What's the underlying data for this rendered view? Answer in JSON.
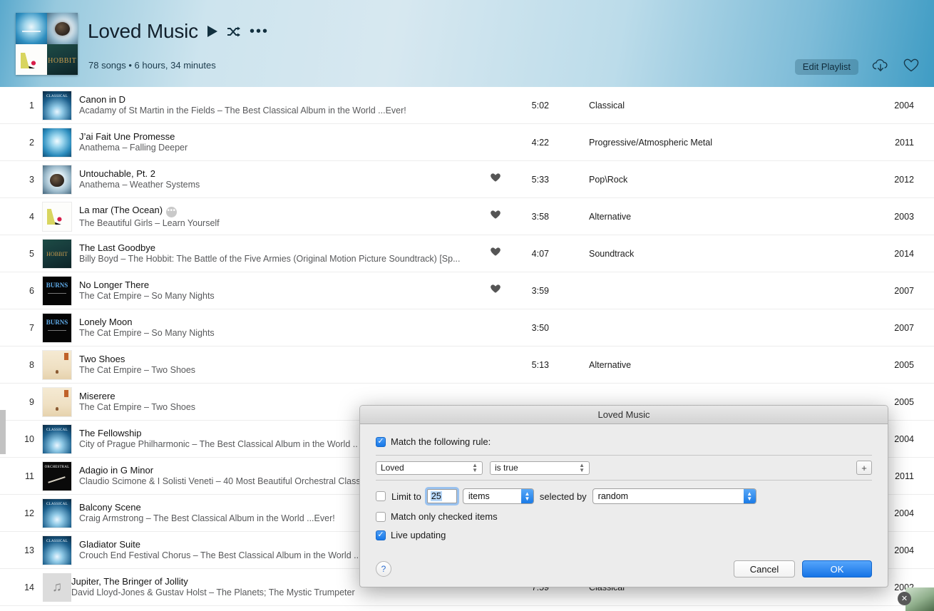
{
  "header": {
    "playlist_title": "Loved Music",
    "play_icon": "play-icon",
    "shuffle_icon": "shuffle-icon",
    "more_icon": "ellipsis-icon",
    "more_glyph": "•••",
    "shuffle_glyph": "⤨",
    "subtitle": "78 songs • 6 hours, 34 minutes",
    "edit_playlist_label": "Edit Playlist",
    "cloud_icon": "cloud-download-icon",
    "heart_icon": "heart-outline-icon",
    "accent_blue": "#3f9cc4",
    "title_color": "#12202c"
  },
  "tracks": [
    {
      "index": "1",
      "title": "Canon in D",
      "subtitle": "Acadamy of St Martin in the Fields – The Best Classical Album in the World ...Ever!",
      "loved": false,
      "time": "5:02",
      "genre": "Classical",
      "year": "2004",
      "art": "a-class",
      "badge": ""
    },
    {
      "index": "2",
      "title": "J’ai Fait Une Promesse",
      "subtitle": "Anathema – Falling Deeper",
      "loved": false,
      "time": "4:22",
      "genre": "Progressive/Atmospheric  Metal",
      "year": "2011",
      "art": "a-anat1",
      "badge": ""
    },
    {
      "index": "3",
      "title": "Untouchable, Pt. 2",
      "subtitle": "Anathema – Weather Systems",
      "loved": true,
      "time": "5:33",
      "genre": "Pop\\Rock",
      "year": "2012",
      "art": "a-anat2",
      "badge": ""
    },
    {
      "index": "4",
      "title": "La mar (The Ocean)",
      "subtitle": "The Beautiful Girls – Learn Yourself",
      "loved": true,
      "time": "3:58",
      "genre": "Alternative",
      "year": "2003",
      "art": "a-bg",
      "badge": "•••"
    },
    {
      "index": "5",
      "title": "The Last Goodbye",
      "subtitle": "Billy Boyd – The Hobbit: The Battle of the Five Armies (Original Motion Picture Soundtrack) [Sp...",
      "loved": true,
      "time": "4:07",
      "genre": "Soundtrack",
      "year": "2014",
      "art": "a-hob",
      "badge": ""
    },
    {
      "index": "6",
      "title": "No Longer There",
      "subtitle": "The Cat Empire – So Many Nights",
      "loved": true,
      "time": "3:59",
      "genre": "",
      "year": "2007",
      "art": "a-burn",
      "badge": ""
    },
    {
      "index": "7",
      "title": "Lonely Moon",
      "subtitle": "The Cat Empire – So Many Nights",
      "loved": false,
      "time": "3:50",
      "genre": "",
      "year": "2007",
      "art": "a-burn",
      "badge": ""
    },
    {
      "index": "8",
      "title": "Two Shoes",
      "subtitle": "The Cat Empire – Two Shoes",
      "loved": false,
      "time": "5:13",
      "genre": "Alternative",
      "year": "2005",
      "art": "a-shoes",
      "badge": ""
    },
    {
      "index": "9",
      "title": "Miserere",
      "subtitle": "The Cat Empire – Two Shoes",
      "loved": false,
      "time": "",
      "genre": "",
      "year": "2005",
      "art": "a-shoes",
      "badge": ""
    },
    {
      "index": "10",
      "title": "The Fellowship",
      "subtitle": "City of Prague Philharmonic – The Best Classical Album in the World ..",
      "loved": false,
      "time": "",
      "genre": "",
      "year": "2004",
      "art": "a-class",
      "badge": ""
    },
    {
      "index": "11",
      "title": "Adagio in G Minor",
      "subtitle": "Claudio Scimone & I Solisti Veneti – 40 Most Beautiful Orchestral Class",
      "loved": false,
      "time": "",
      "genre": "",
      "year": "2011",
      "art": "a-orch",
      "badge": ""
    },
    {
      "index": "12",
      "title": "Balcony Scene",
      "subtitle": "Craig Armstrong – The Best Classical Album in the World ...Ever!",
      "loved": false,
      "time": "",
      "genre": "",
      "year": "2004",
      "art": "a-class",
      "badge": ""
    },
    {
      "index": "13",
      "title": "Gladiator Suite",
      "subtitle": "Crouch End Festival Chorus – The Best Classical Album in the World ..",
      "loved": false,
      "time": "",
      "genre": "",
      "year": "2004",
      "art": "a-class",
      "badge": ""
    },
    {
      "index": "14",
      "title": "Jupiter, The Bringer of Jollity",
      "subtitle": "David Lloyd-Jones & Gustav Holst – The Planets; The Mystic Trumpeter",
      "loved": false,
      "time": "7:59",
      "genre": "Classical",
      "year": "2002",
      "art": "ph-note",
      "badge": ""
    }
  ],
  "dialog": {
    "title": "Loved Music",
    "match_rule_label": "Match the following rule:",
    "match_rule_checked": true,
    "rule_field": "Loved",
    "rule_operator": "is true",
    "add_rule_glyph": "+",
    "limit_to_label": "Limit to",
    "limit_checked": false,
    "limit_value": "25",
    "limit_unit": "items",
    "selected_by_label": "selected by",
    "selected_by_value": "random",
    "match_checked_label": "Match only checked items",
    "match_checked_checked": false,
    "live_updating_label": "Live updating",
    "live_updating_checked": true,
    "help_glyph": "?",
    "cancel_label": "Cancel",
    "ok_label": "OK",
    "primary_color": "#1674e6"
  },
  "chrome": {
    "close_badge_glyph": "✕",
    "note_glyph": "♫"
  }
}
